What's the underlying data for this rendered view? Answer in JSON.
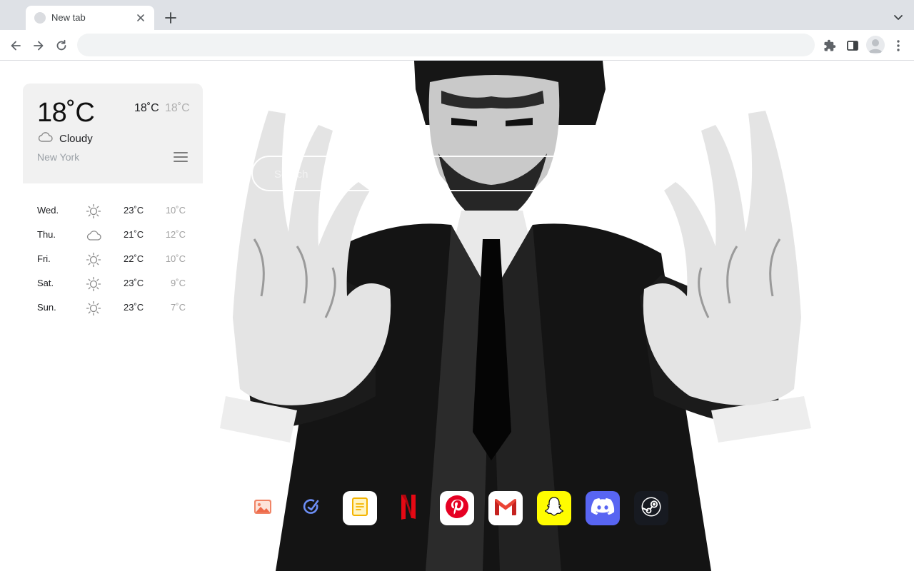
{
  "browser": {
    "tab": {
      "title": "New tab"
    },
    "omnibox": {
      "value": "",
      "placeholder": ""
    }
  },
  "weather": {
    "current_temp": "18˚C",
    "high": "18˚C",
    "low": "18˚C",
    "condition": "Cloudy",
    "condition_icon": "cloud-icon",
    "city": "New York",
    "forecast": [
      {
        "day": "Wed.",
        "icon": "sun-icon",
        "high": "23˚C",
        "low": "10˚C"
      },
      {
        "day": "Thu.",
        "icon": "cloud-icon",
        "high": "21˚C",
        "low": "12˚C"
      },
      {
        "day": "Fri.",
        "icon": "sun-icon",
        "high": "22˚C",
        "low": "10˚C"
      },
      {
        "day": "Sat.",
        "icon": "sun-icon",
        "high": "23˚C",
        "low": "9˚C"
      },
      {
        "day": "Sun.",
        "icon": "sun-icon",
        "high": "23˚C",
        "low": "7˚C"
      }
    ]
  },
  "search": {
    "placeholder": "Search",
    "value": ""
  },
  "shortcuts": [
    {
      "name": "Photos",
      "icon": "photos-icon",
      "color": "#ee6a4a"
    },
    {
      "name": "Tasks",
      "icon": "tasks-icon",
      "color": "#6c8ef5"
    },
    {
      "name": "Notes",
      "icon": "notes-icon",
      "color": "#f4b400"
    },
    {
      "name": "Netflix",
      "icon": "netflix-icon",
      "color": "#e50914"
    },
    {
      "name": "Pinterest",
      "icon": "pinterest-icon",
      "color": "#e60023"
    },
    {
      "name": "Gmail",
      "icon": "gmail-icon",
      "color": "#ea4335"
    },
    {
      "name": "Snapchat",
      "icon": "snapchat-icon",
      "color": "#fffc00"
    },
    {
      "name": "Discord",
      "icon": "discord-icon",
      "color": "#5865f2"
    },
    {
      "name": "Steam",
      "icon": "steam-icon",
      "color": "#171a21"
    }
  ]
}
